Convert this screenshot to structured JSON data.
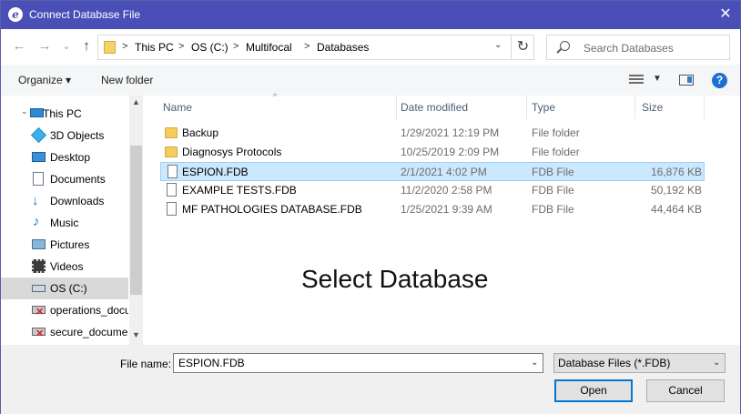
{
  "window": {
    "title": "Connect Database File",
    "app_icon": "e-app-icon",
    "close_symbol": "✕"
  },
  "nav": {
    "back_symbol": "←",
    "forward_symbol": "→",
    "recent_symbol": "⌄",
    "up_symbol": "↑",
    "breadcrumbs": [
      "This PC",
      "OS (C:)",
      "Multifocal",
      "Databases"
    ],
    "separator": ">",
    "refresh_symbol": "↻",
    "search_placeholder": "Search Databases"
  },
  "toolbar": {
    "organize": "Organize ▾",
    "new_folder": "New folder",
    "help": "?"
  },
  "sidebar": {
    "items": [
      {
        "label": "This PC",
        "icon": "computer-icon"
      },
      {
        "label": "3D Objects",
        "icon": "cube-icon"
      },
      {
        "label": "Desktop",
        "icon": "desktop-icon"
      },
      {
        "label": "Documents",
        "icon": "document-icon"
      },
      {
        "label": "Downloads",
        "icon": "download-icon"
      },
      {
        "label": "Music",
        "icon": "music-icon"
      },
      {
        "label": "Pictures",
        "icon": "picture-icon"
      },
      {
        "label": "Videos",
        "icon": "video-icon"
      },
      {
        "label": "OS (C:)",
        "icon": "drive-icon",
        "selected": true
      },
      {
        "label": "operations_docu",
        "icon": "network-drive-disconnected-icon"
      },
      {
        "label": "secure_documen",
        "icon": "network-drive-disconnected-icon"
      }
    ]
  },
  "columns": {
    "name": "Name",
    "date": "Date modified",
    "type": "Type",
    "size": "Size"
  },
  "files": [
    {
      "name": "Backup",
      "date": "1/29/2021 12:19 PM",
      "type": "File folder",
      "size": "",
      "kind": "folder"
    },
    {
      "name": "Diagnosys Protocols",
      "date": "10/25/2019 2:09 PM",
      "type": "File folder",
      "size": "",
      "kind": "folder"
    },
    {
      "name": "ESPION.FDB",
      "date": "2/1/2021 4:02 PM",
      "type": "FDB File",
      "size": "16,876 KB",
      "kind": "file",
      "selected": true
    },
    {
      "name": "EXAMPLE TESTS.FDB",
      "date": "11/2/2020 2:58 PM",
      "type": "FDB File",
      "size": "50,192 KB",
      "kind": "file"
    },
    {
      "name": "MF PATHOLOGIES DATABASE.FDB",
      "date": "1/25/2021 9:39 AM",
      "type": "FDB File",
      "size": "44,464 KB",
      "kind": "file"
    }
  ],
  "overlay_text": "Select Database",
  "footer": {
    "file_name_label": "File name:",
    "file_name_value": "ESPION.FDB",
    "file_type": "Database Files (*.FDB)",
    "open": "Open",
    "cancel": "Cancel"
  },
  "colors": {
    "titlebar": "#4a4fb8",
    "selection": "#cce8ff",
    "accent": "#0078d7"
  }
}
